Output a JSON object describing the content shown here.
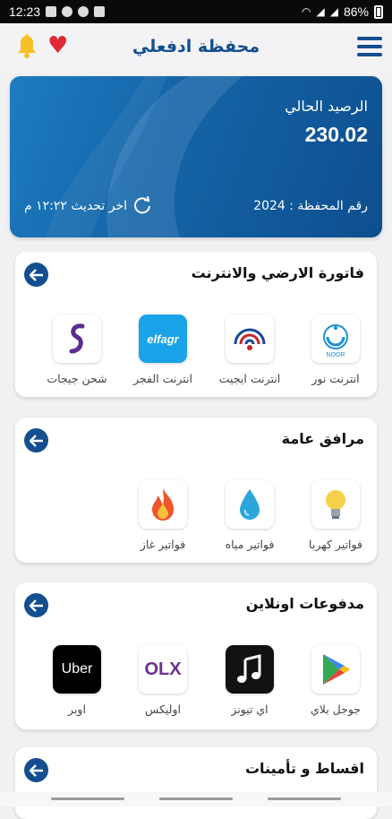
{
  "status_bar": {
    "time": "12:23",
    "battery": "86%"
  },
  "header": {
    "title": "محفظة ادفعلي"
  },
  "wallet": {
    "balance_label": "الرصيد الحالي",
    "balance": "230.02",
    "wallet_number_label": "رقم المحفظة : 2024",
    "last_update": "اخر تحديث ١٢:٢٢ م"
  },
  "sections": [
    {
      "title": "فاتورة الارضي والانترنت",
      "items": [
        {
          "label": "انترنت نور",
          "icon": "noor-icon"
        },
        {
          "label": "انترنت ايجيت",
          "icon": "egynet-icon"
        },
        {
          "label": "انترنت الفجر",
          "icon": "elfagr-icon",
          "icon_text": "elfagr"
        },
        {
          "label": "شحن جيجات",
          "icon": "we-icon"
        }
      ]
    },
    {
      "title": "مرافق عامة",
      "items": [
        {
          "label": "فواتير كهربا",
          "icon": "lightbulb-icon"
        },
        {
          "label": "فواتير مياه",
          "icon": "water-drop-icon"
        },
        {
          "label": "فواتير غاز",
          "icon": "fire-icon"
        }
      ]
    },
    {
      "title": "مدفوعات اونلاين",
      "items": [
        {
          "label": "جوجل بلاي",
          "icon": "google-play-icon"
        },
        {
          "label": "اي تيونز",
          "icon": "itunes-icon"
        },
        {
          "label": "اوليكس",
          "icon": "olx-icon",
          "icon_text": "OLX"
        },
        {
          "label": "اوبر",
          "icon": "uber-icon",
          "icon_text": "Uber"
        }
      ]
    },
    {
      "title": "اقساط و تأمينات",
      "items": []
    }
  ],
  "colors": {
    "primary": "#124e90",
    "heart": "#e02a36",
    "bell": "#f5c022"
  }
}
